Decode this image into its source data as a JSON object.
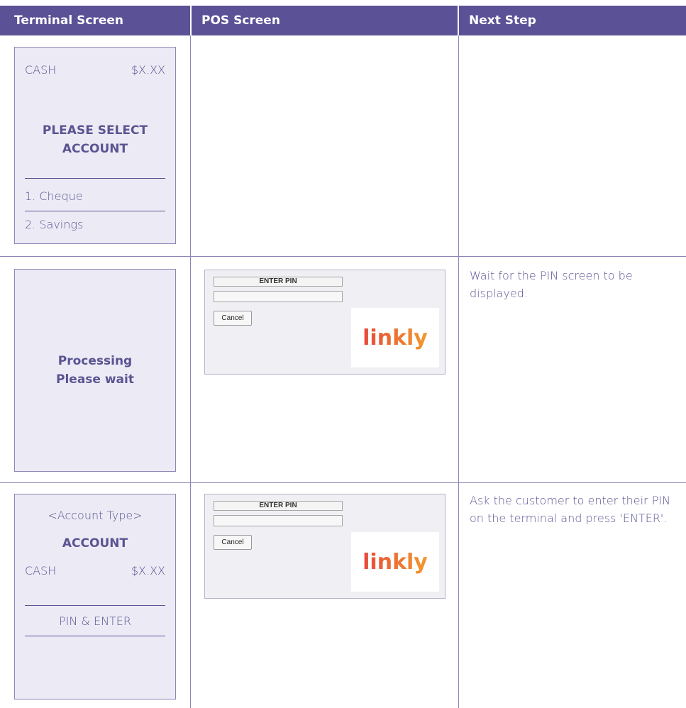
{
  "header": {
    "col1": "Terminal Screen",
    "col2": "POS Screen",
    "col3": "Next Step"
  },
  "colors": {
    "header_bg": "#5b5196",
    "panel_bg": "#ecebf5",
    "text": "#5a5492",
    "logo_gradient": [
      "#e6493a",
      "#f29a2e"
    ]
  },
  "rows": [
    {
      "terminal": {
        "cash_label": "CASH",
        "amount": "$X.XX",
        "heading_line1": "PLEASE SELECT",
        "heading_line2": "ACCOUNT",
        "option1": "1. Cheque",
        "option2": "2. Savings"
      },
      "next_step": ""
    },
    {
      "terminal": {
        "line1": "Processing",
        "line2": "Please wait"
      },
      "pos": {
        "title": "ENTER PIN",
        "cancel_label": "Cancel",
        "logo_text": "linkly"
      },
      "next_step": "Wait for the PIN screen to be displayed."
    },
    {
      "terminal": {
        "account_type": "<Account Type>",
        "account_label": "ACCOUNT",
        "cash_label": "CASH",
        "amount": "$X.XX",
        "prompt": "PIN & ENTER"
      },
      "pos": {
        "title": "ENTER PIN",
        "cancel_label": "Cancel",
        "logo_text": "linkly"
      },
      "next_step": "Ask the customer to enter their PIN on the terminal and press 'ENTER'."
    }
  ]
}
